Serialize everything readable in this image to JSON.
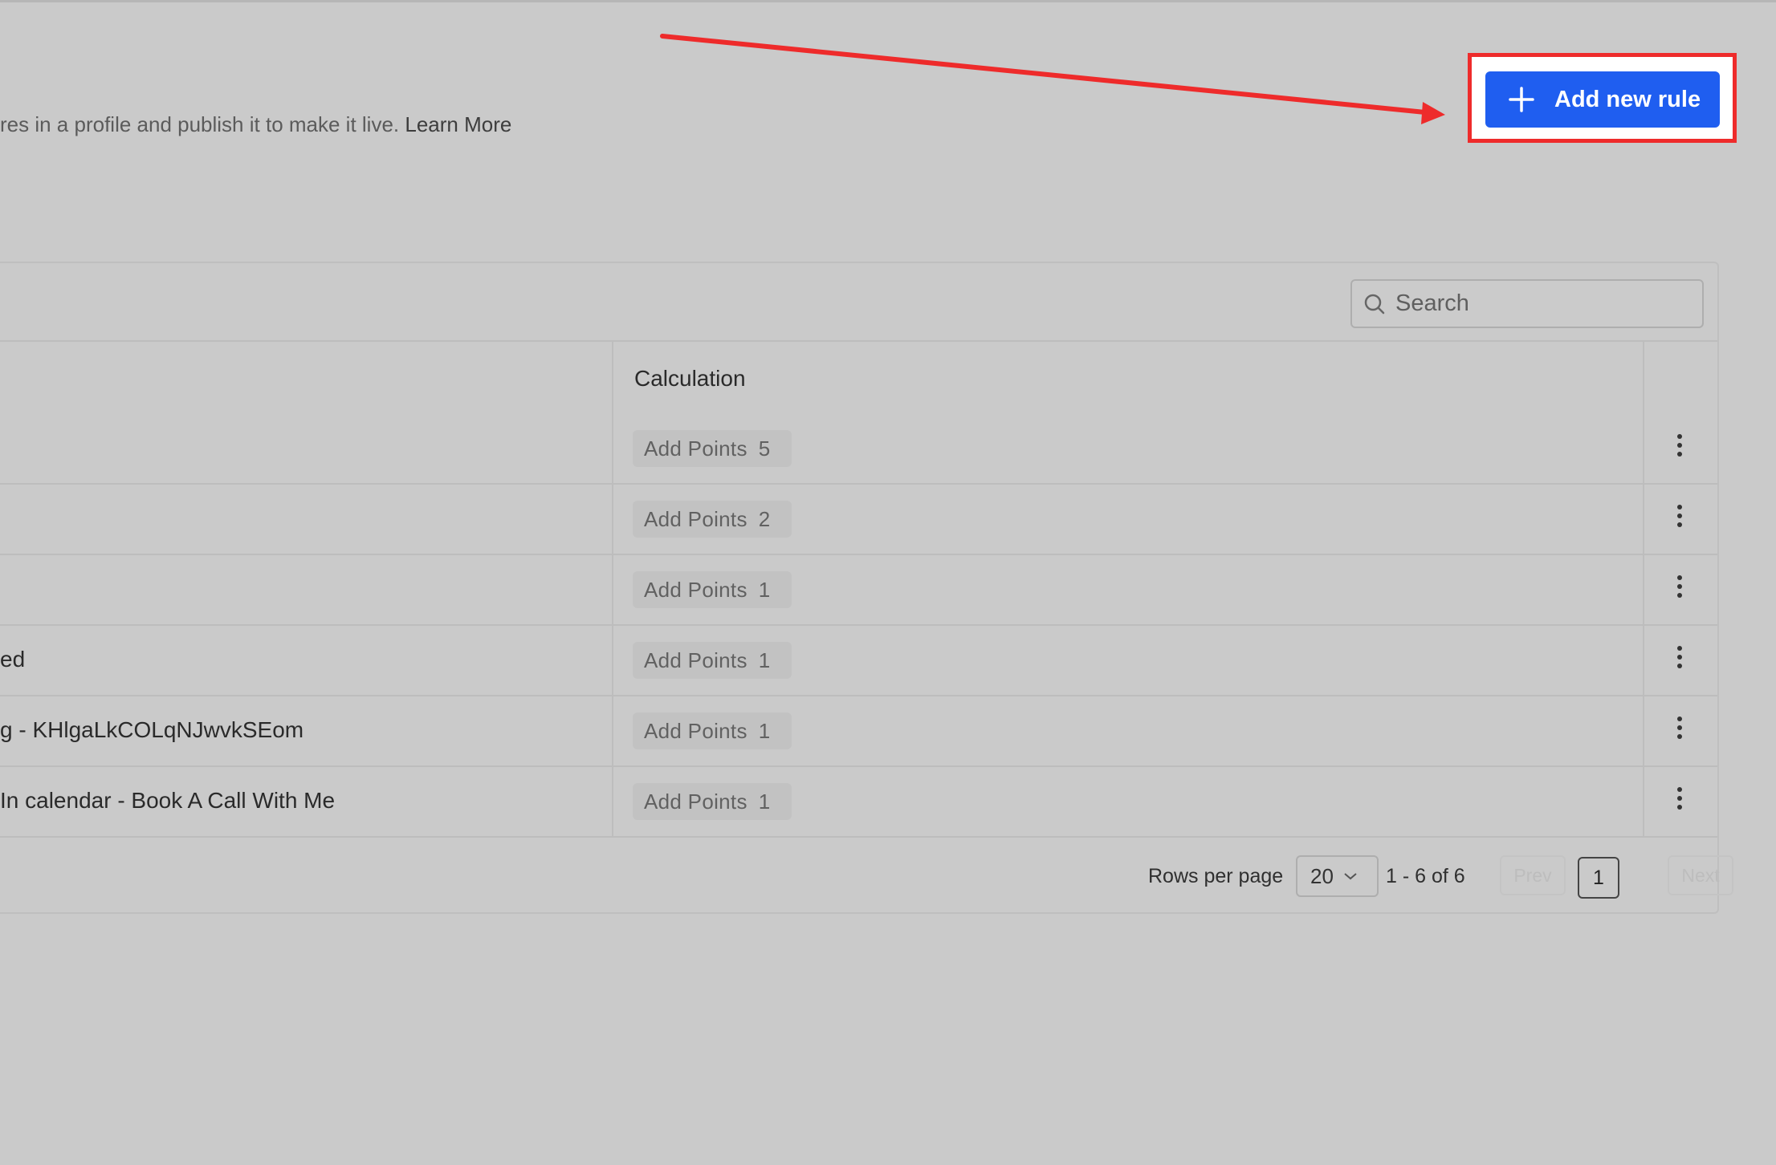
{
  "header": {
    "description_text": "res in a profile and publish it to make it live.",
    "learn_more": "Learn More",
    "add_button_label": "Add new rule"
  },
  "search": {
    "placeholder": "Search"
  },
  "table": {
    "columns": [
      "Calculation"
    ],
    "rows": [
      {
        "name": "",
        "action": "Add Points",
        "points": "5"
      },
      {
        "name": "",
        "action": "Add Points",
        "points": "2"
      },
      {
        "name": "",
        "action": "Add Points",
        "points": "1"
      },
      {
        "name": "ed",
        "action": "Add Points",
        "points": "1"
      },
      {
        "name": "g - KHlgaLkCOLqNJwvkSEom",
        "action": "Add Points",
        "points": "1"
      },
      {
        "name": " In calendar - Book A Call With Me",
        "action": "Add Points",
        "points": "1"
      }
    ]
  },
  "pagination": {
    "rows_per_page_label": "Rows per page",
    "rows_per_page_value": "20",
    "range_text": "1 - 6 of 6",
    "prev_label": "Prev",
    "current_page": "1",
    "next_label": "Next"
  },
  "colors": {
    "accent": "#1f5ef0",
    "annotation": "#ee2b2b",
    "background": "#cacaca"
  },
  "icons": [
    "plus-icon",
    "search-icon",
    "chevron-down-icon",
    "more-vertical-icon",
    "annotation-arrow"
  ]
}
